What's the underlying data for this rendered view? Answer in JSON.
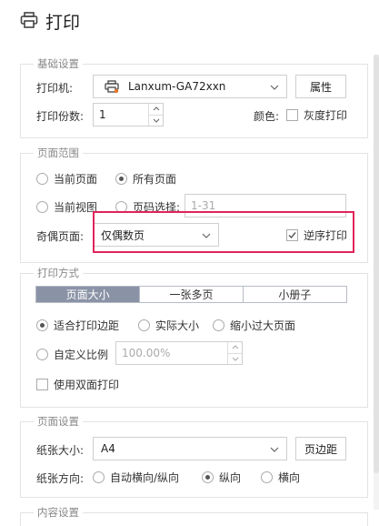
{
  "title": "打印",
  "basic": {
    "legend": "基础设置",
    "printer_label": "打印机:",
    "printer_value": "Lanxum-GA72xxn",
    "properties_button": "属性",
    "copies_label": "打印份数:",
    "copies_value": "1",
    "color_label": "颜色:",
    "grayscale_label": "灰度打印"
  },
  "range": {
    "legend": "页面范围",
    "current_page": "当前页面",
    "all_pages": "所有页面",
    "current_view": "当前视图",
    "page_select": "页码选择:",
    "page_select_placeholder": "1-31",
    "odd_even_label": "奇偶页面:",
    "odd_even_value": "仅偶数页",
    "reverse_label": "逆序打印"
  },
  "print_mode": {
    "legend": "打印方式",
    "tabs": [
      "页面大小",
      "一张多页",
      "小册子"
    ],
    "fit_margin": "适合打印边距",
    "actual_size": "实际大小",
    "shrink_large": "缩小过大页面",
    "custom_scale": "自定义比例",
    "custom_scale_value": "100.00%",
    "duplex": "使用双面打印"
  },
  "page_setup": {
    "legend": "页面设置",
    "paper_size_label": "纸张大小:",
    "paper_size_value": "A4",
    "margin_button": "页边距",
    "orientation_label": "纸张方向:",
    "auto_orientation": "自动横向/纵向",
    "portrait": "纵向",
    "landscape": "横向"
  },
  "content": {
    "legend": "内容设置"
  },
  "colors": {
    "highlight": "#e0245a",
    "active_tab": "#8a93a6",
    "printer_icon_accent": "#e8742a"
  }
}
